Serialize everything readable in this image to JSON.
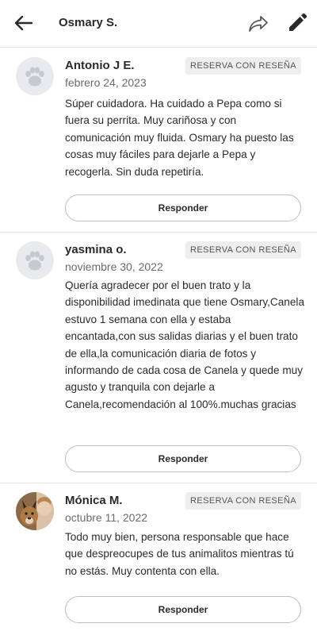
{
  "header": {
    "title": "Osmary S."
  },
  "badge_label": "RESERVA CON RESEÑA",
  "reply_label": "Responder",
  "reviews": [
    {
      "name": "Antonio J E.",
      "date": "febrero 24, 2023",
      "avatar": "paw-icon",
      "text": "Súper cuidadora. Ha cuidado a Pepa como si fuera su perrita. Muy cariñosa y con comunicación muy fluida. Osmary ha puesto las cosas muy fáciles para dejarle a Pepa y recogerla. Sin duda repetiría."
    },
    {
      "name": "yasmina o.",
      "date": "noviembre 30, 2022",
      "avatar": "paw-icon",
      "text": "Quería agradecer por el buen trato y la disponibilidad imedinata que tiene Osmary,Canela estuvo 1 semana con ella y estaba encantada,con sus salidas diarias y el buen trato de ella,la comunicación diaria de fotos y informando de cada cosa de Canela y quede muy agusto y tranquila con dejarle a Canela,recomendación al 100%.muchas gracias"
    },
    {
      "name": "Mónica M.",
      "date": "octubre 11, 2022",
      "avatar": "user-photo",
      "text": "Todo muy bien, persona responsable que hace que despreocupes de tus animalitos mientras tú no estás. Muy contenta con ella."
    }
  ]
}
